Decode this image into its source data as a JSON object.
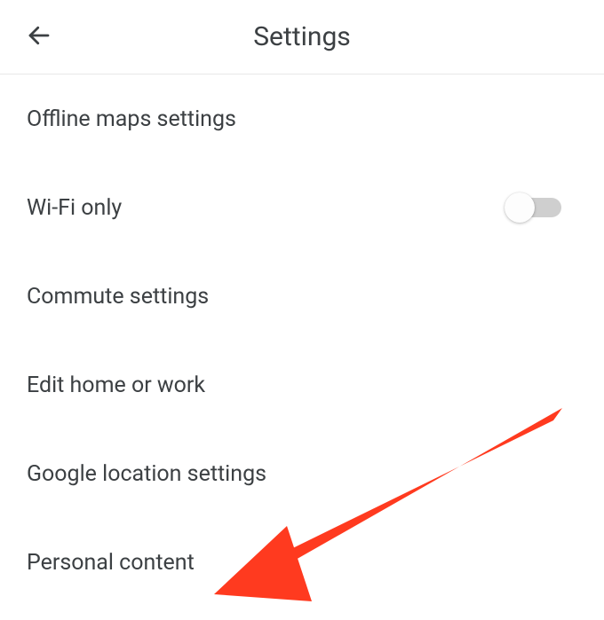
{
  "header": {
    "title": "Settings"
  },
  "items": [
    {
      "label": "Offline maps settings",
      "has_toggle": false
    },
    {
      "label": "Wi-Fi only",
      "has_toggle": true,
      "toggle_on": false
    },
    {
      "label": "Commute settings",
      "has_toggle": false
    },
    {
      "label": "Edit home or work",
      "has_toggle": false
    },
    {
      "label": "Google location settings",
      "has_toggle": false
    },
    {
      "label": "Personal content",
      "has_toggle": false
    }
  ],
  "annotation": {
    "type": "arrow",
    "color": "#ff3a1f",
    "points_to": "Personal content"
  }
}
